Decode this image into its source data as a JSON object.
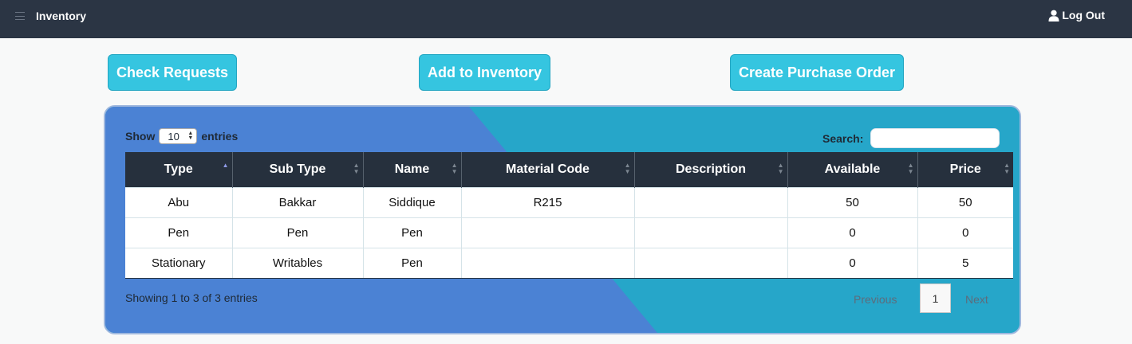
{
  "navbar": {
    "title": "Inventory",
    "logout_label": "Log Out"
  },
  "actions": {
    "check_requests": "Check Requests",
    "add_to_inventory": "Add to Inventory",
    "create_purchase_order": "Create Purchase Order"
  },
  "table_controls": {
    "show_label": "Show",
    "entries_value": "10",
    "entries_label": "entries",
    "search_label": "Search:",
    "search_value": ""
  },
  "table": {
    "columns": [
      "Type",
      "Sub Type",
      "Name",
      "Material Code",
      "Description",
      "Available",
      "Price"
    ],
    "sorted_column": "Type",
    "rows": [
      [
        "Abu",
        "Bakkar",
        "Siddique",
        "R215",
        "",
        "50",
        "50"
      ],
      [
        "Pen",
        "Pen",
        "Pen",
        "",
        "",
        "0",
        "0"
      ],
      [
        "Stationary",
        "Writables",
        "Pen",
        "",
        "",
        "0",
        "5"
      ]
    ]
  },
  "footer": {
    "info": "Showing 1 to 3 of 3 entries",
    "previous": "Previous",
    "current_page": "1",
    "next": "Next"
  },
  "colors": {
    "navbar": "#2b3544",
    "button": "#35c5e0",
    "panel_blue": "#4b82d4",
    "panel_teal": "#26a6c9",
    "table_header": "#26303d"
  }
}
